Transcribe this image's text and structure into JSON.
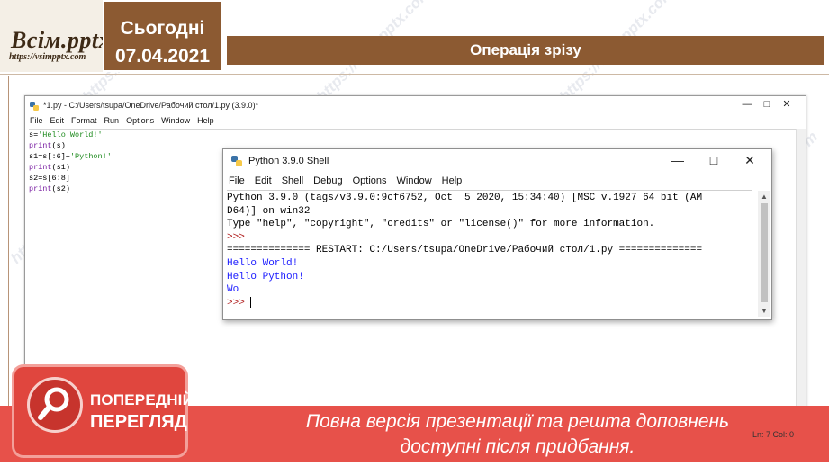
{
  "slide": {
    "logo_text": "Всім.pptx",
    "logo_url": "https://vsimpptx.com",
    "date_label": "Сьогодні",
    "date_value": "07.04.2021",
    "title": "Операція зрізу"
  },
  "editor": {
    "title": "*1.py - C:/Users/tsupa/OneDrive/Рабочий стол/1.py (3.9.0)*",
    "menu": [
      "File",
      "Edit",
      "Format",
      "Run",
      "Options",
      "Window",
      "Help"
    ],
    "code": [
      {
        "a": "s=",
        "b": "'Hello World!'",
        "c": ""
      },
      {
        "a": "print",
        "b": "(s)",
        "c": ""
      },
      {
        "a": "s1=s[:6]+",
        "b": "'Python!'",
        "c": ""
      },
      {
        "a": "print",
        "b": "(s1)",
        "c": ""
      },
      {
        "a": "s2=s[6:8]",
        "b": "",
        "c": ""
      },
      {
        "a": "print",
        "b": "(s2)",
        "c": ""
      }
    ],
    "status": "Ln: 7   Col: 0"
  },
  "shell": {
    "title": "Python 3.9.0 Shell",
    "menu": [
      "File",
      "Edit",
      "Shell",
      "Debug",
      "Options",
      "Window",
      "Help"
    ],
    "lines": {
      "l1": "Python 3.9.0 (tags/v3.9.0:9cf6752, Oct  5 2020, 15:34:40) [MSC v.1927 64 bit (AM",
      "l2": "D64)] on win32",
      "l3": "Type \"help\", \"copyright\", \"credits\" or \"license()\" for more information.",
      "l4": ">>> ",
      "l5": "============== RESTART: C:/Users/tsupa/OneDrive/Рабочий стол/1.py ==============",
      "l6": "Hello World!",
      "l7": "Hello Python!",
      "l8": "Wo",
      "l9": ">>> "
    }
  },
  "banner": {
    "badge_line1": "ПОПЕРЕДНІЙ",
    "badge_line2": "ПЕРЕГЛЯД",
    "text_line1": "Повна версія презентації та решта доповнень",
    "text_line2": "доступні після придбання."
  },
  "icons": [
    "python-icon",
    "minimize-icon",
    "maximize-icon",
    "close-icon",
    "search-icon"
  ],
  "colors": {
    "header": "#8c5a32",
    "banner": "#e7514a",
    "stdout": "#1a1aff"
  }
}
